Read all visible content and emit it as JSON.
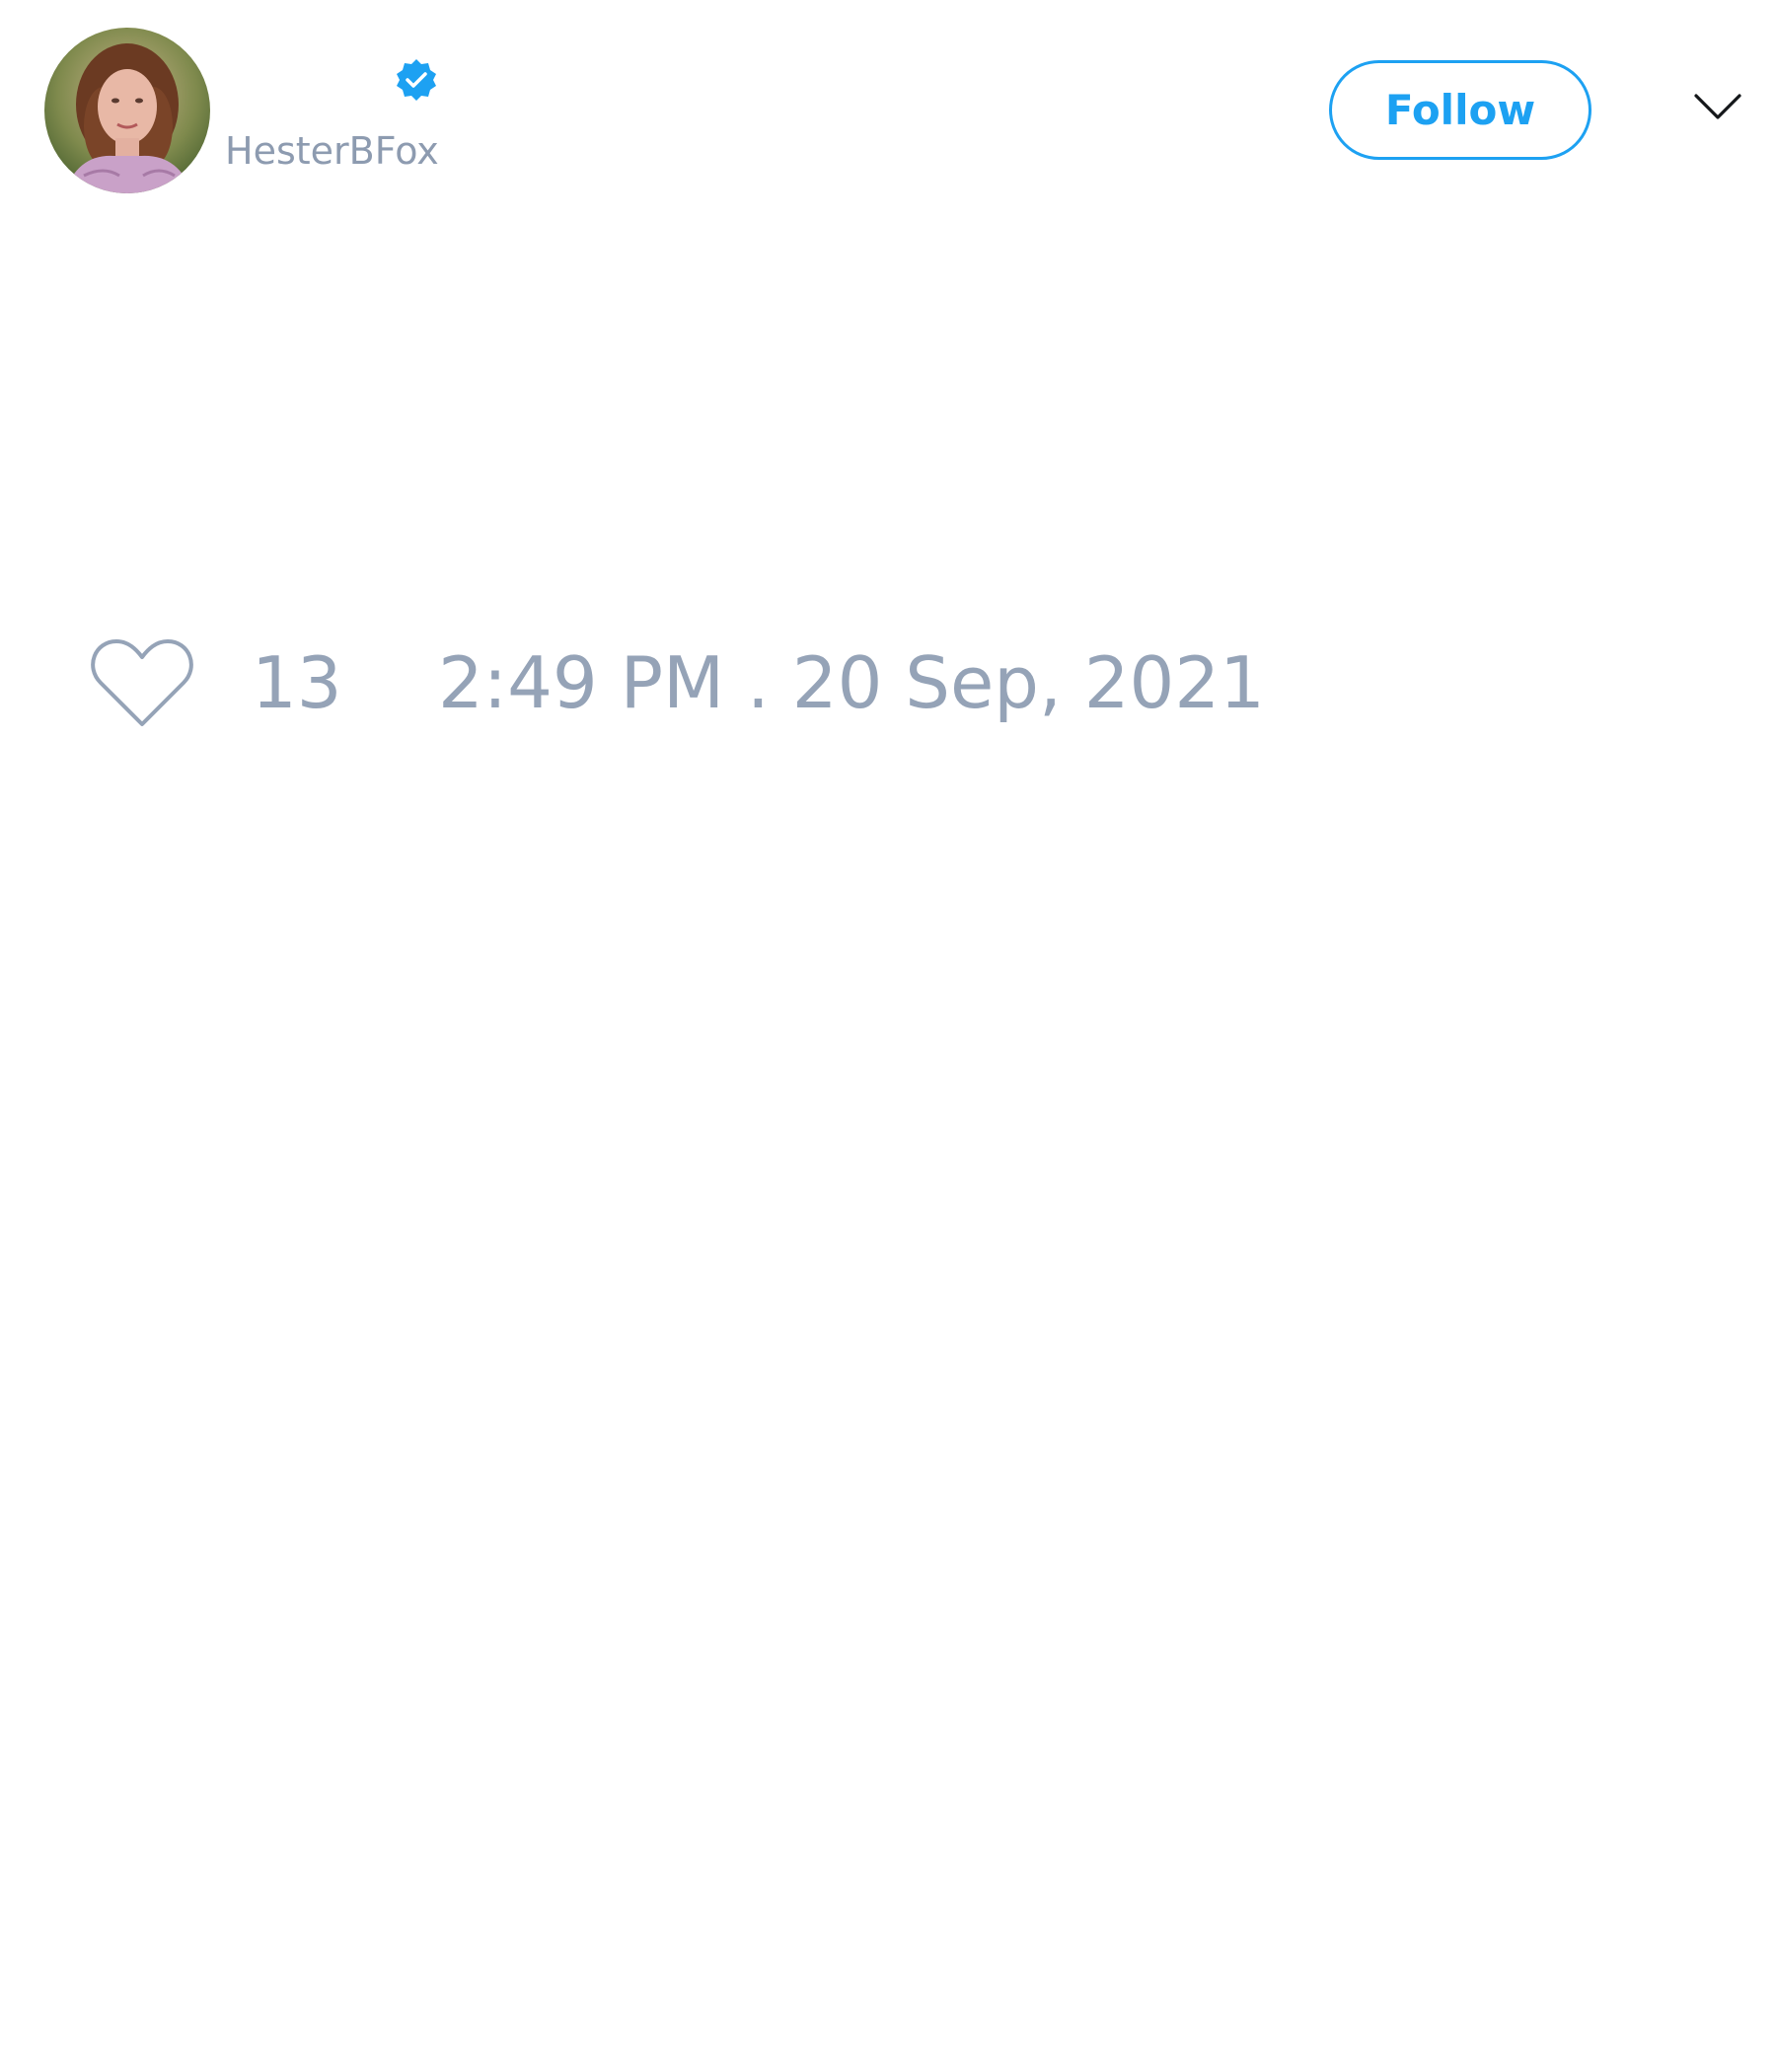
{
  "tweet": {
    "author": {
      "username": "HesterBFox",
      "verified": true
    },
    "follow_label": "Follow",
    "likes": "13",
    "timestamp": "2:49 PM . 20 Sep, 2021"
  },
  "icons": {
    "verified": "verified-badge-icon",
    "menu": "chevron-down-icon",
    "like": "heart-outline-icon"
  },
  "colors": {
    "accent": "#1da1f2",
    "muted_text": "#8d9bb0"
  }
}
